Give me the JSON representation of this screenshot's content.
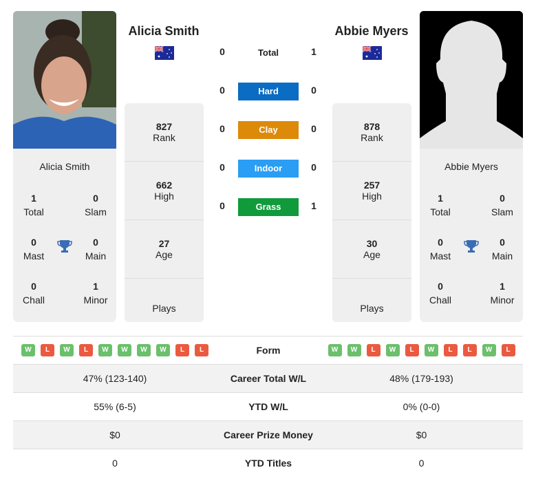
{
  "players": [
    {
      "name": "Alicia Smith",
      "country_flag": "australia-flag",
      "rank": "827",
      "rank_label": "Rank",
      "high": "662",
      "high_label": "High",
      "age": "27",
      "age_label": "Age",
      "plays_label": "Plays",
      "titles": {
        "total": "1",
        "total_label": "Total",
        "slam": "0",
        "slam_label": "Slam",
        "mast": "0",
        "mast_label": "Mast",
        "main": "0",
        "main_label": "Main",
        "chall": "0",
        "chall_label": "Chall",
        "minor": "1",
        "minor_label": "Minor"
      },
      "form": [
        "W",
        "L",
        "W",
        "L",
        "W",
        "W",
        "W",
        "W",
        "L",
        "L"
      ]
    },
    {
      "name": "Abbie Myers",
      "country_flag": "australia-flag",
      "rank": "878",
      "rank_label": "Rank",
      "high": "257",
      "high_label": "High",
      "age": "30",
      "age_label": "Age",
      "plays_label": "Plays",
      "titles": {
        "total": "1",
        "total_label": "Total",
        "slam": "0",
        "slam_label": "Slam",
        "mast": "0",
        "mast_label": "Mast",
        "main": "0",
        "main_label": "Main",
        "chall": "0",
        "chall_label": "Chall",
        "minor": "1",
        "minor_label": "Minor"
      },
      "form": [
        "W",
        "W",
        "L",
        "W",
        "L",
        "W",
        "L",
        "L",
        "W",
        "L"
      ]
    }
  ],
  "h2h": {
    "total": {
      "label": "Total",
      "p1": "0",
      "p2": "1"
    },
    "surfaces": [
      {
        "label": "Hard",
        "p1": "0",
        "p2": "0",
        "color": "#0a6cc2"
      },
      {
        "label": "Clay",
        "p1": "0",
        "p2": "0",
        "color": "#dd8a0a"
      },
      {
        "label": "Indoor",
        "p1": "0",
        "p2": "0",
        "color": "#2a9df4"
      },
      {
        "label": "Grass",
        "p1": "0",
        "p2": "1",
        "color": "#119a3c"
      }
    ]
  },
  "comparison": {
    "form_label": "Form",
    "rows": [
      {
        "label": "Career Total W/L",
        "p1": "47% (123-140)",
        "p2": "48% (179-193)"
      },
      {
        "label": "YTD W/L",
        "p1": "55% (6-5)",
        "p2": "0% (0-0)"
      },
      {
        "label": "Career Prize Money",
        "p1": "$0",
        "p2": "$0"
      },
      {
        "label": "YTD Titles",
        "p1": "0",
        "p2": "0"
      }
    ]
  },
  "colors": {
    "win": "#6cbf6c",
    "loss": "#ea5a40",
    "trophy": "#3a6db5"
  }
}
